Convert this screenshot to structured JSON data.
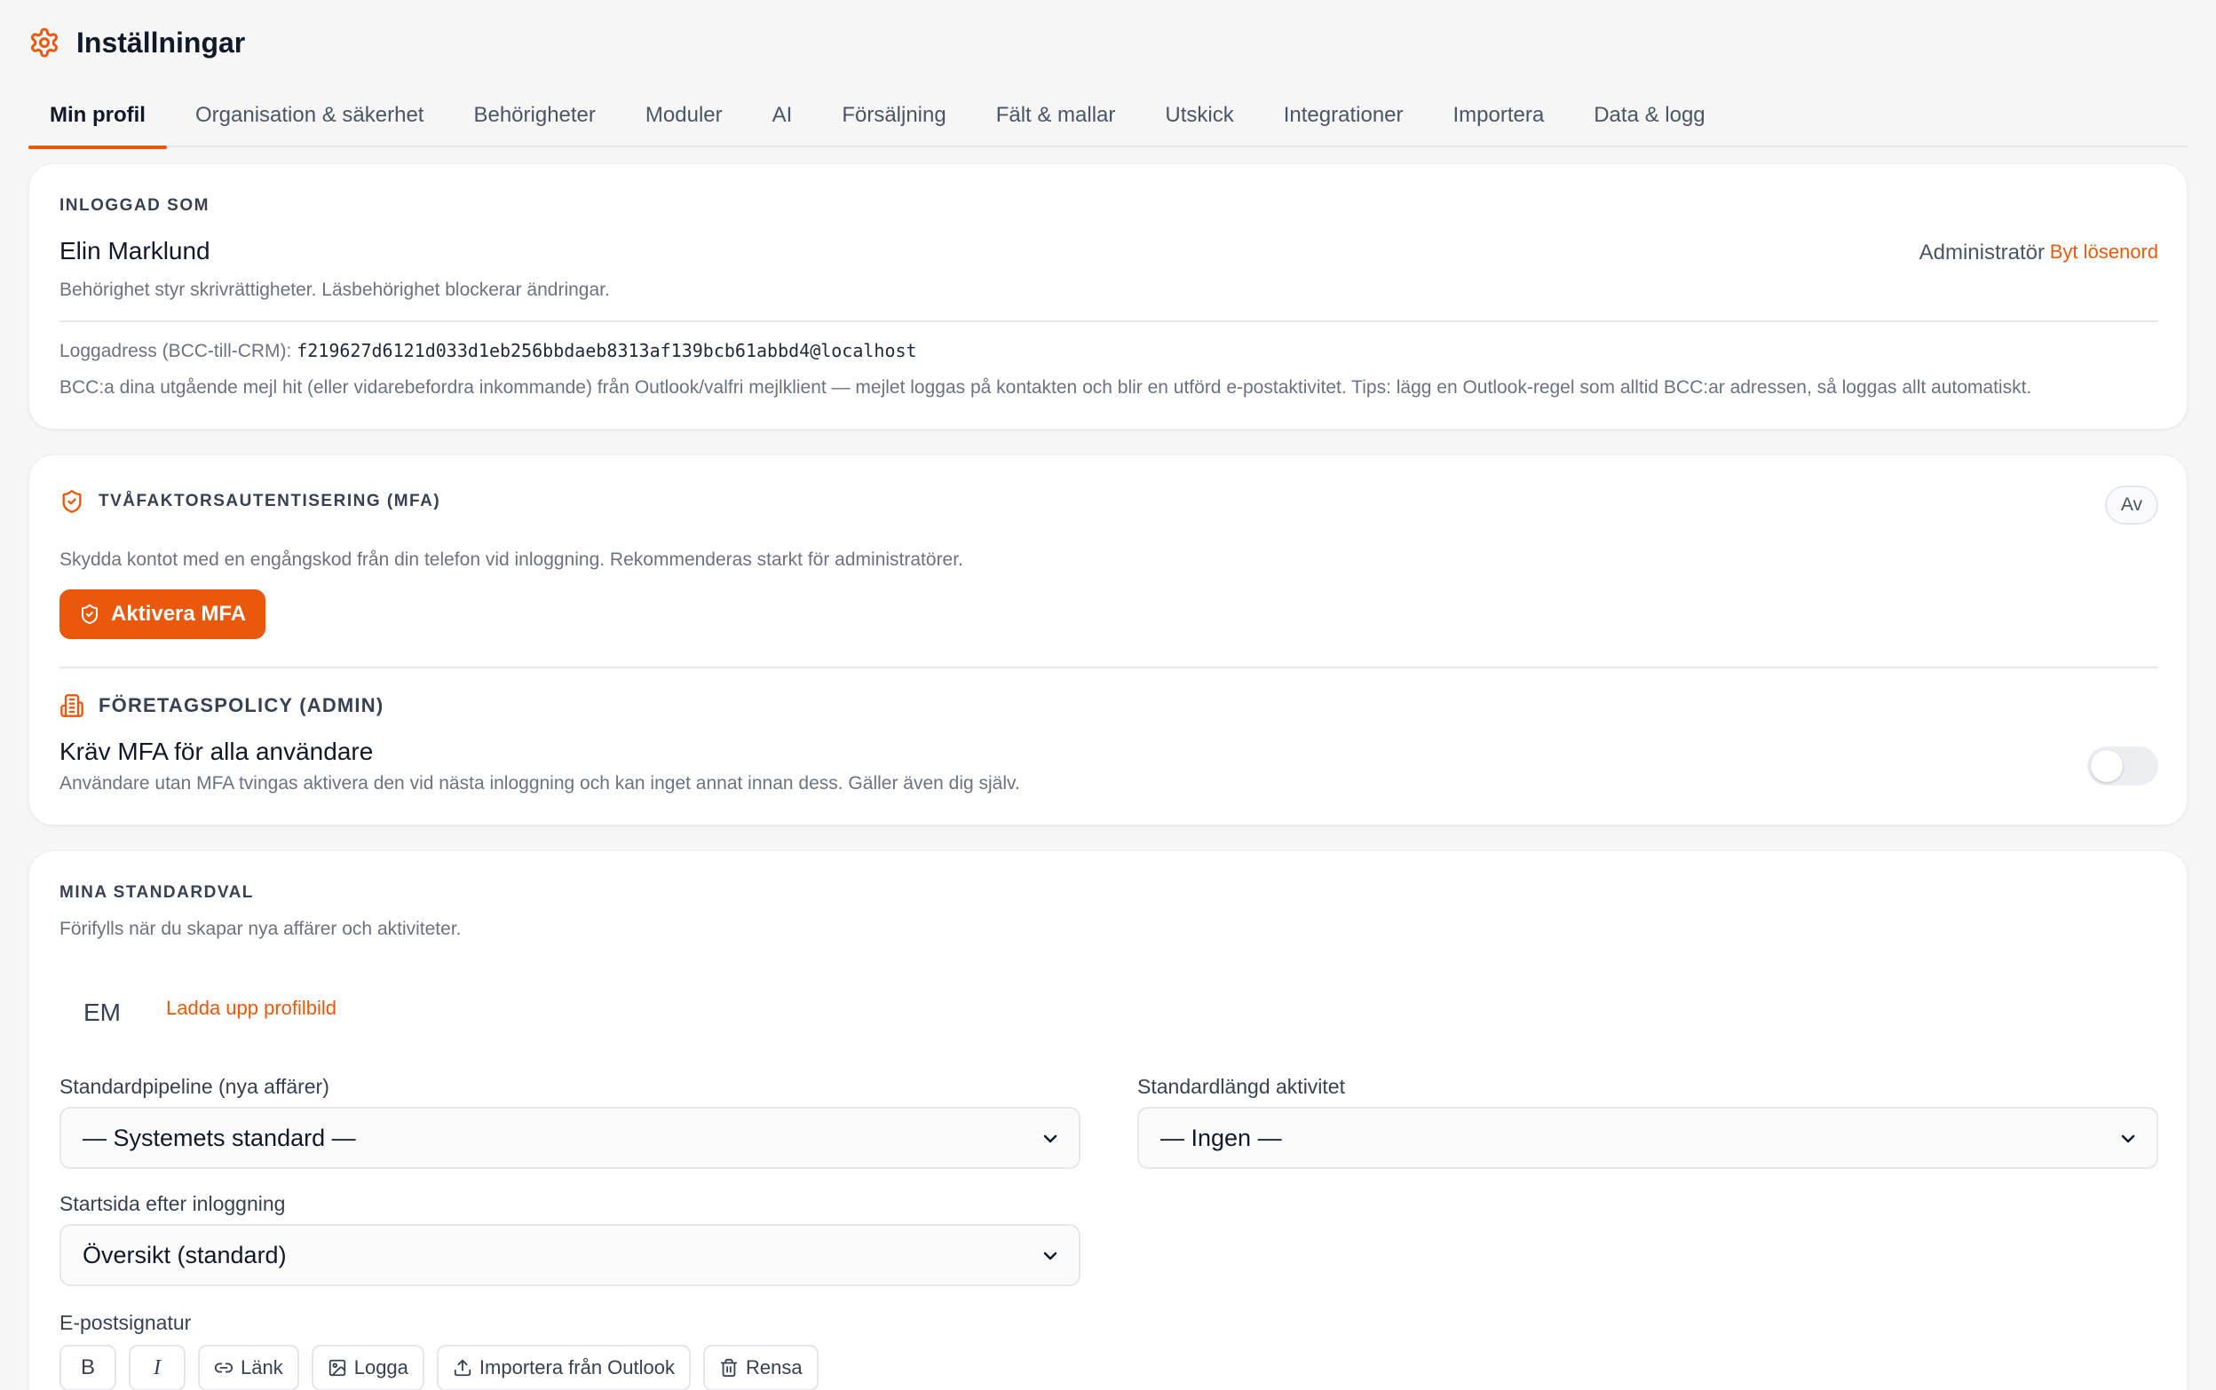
{
  "header": {
    "title": "Inställningar",
    "icon": "gear-icon",
    "accent": "#ea580c"
  },
  "tabs": [
    {
      "label": "Min profil",
      "active": true
    },
    {
      "label": "Organisation & säkerhet"
    },
    {
      "label": "Behörigheter"
    },
    {
      "label": "Moduler"
    },
    {
      "label": "AI"
    },
    {
      "label": "Försäljning"
    },
    {
      "label": "Fält & mallar"
    },
    {
      "label": "Utskick"
    },
    {
      "label": "Integrationer"
    },
    {
      "label": "Importera"
    },
    {
      "label": "Data & logg"
    }
  ],
  "profile": {
    "caption": "INLOGGAD SOM",
    "name": "Elin Marklund",
    "description": "Behörighet styr skrivrättigheter. Läsbehörighet blockerar ändringar.",
    "role": "Administratör",
    "change_password": "Byt lösenord",
    "log_label": "Loggadress (BCC-till-CRM): ",
    "log_address": "f219627d6121d033d1eb256bbdaeb8313af139bcb61abbd4@localhost",
    "bcc_help": "BCC:a dina utgående mejl hit (eller vidarebefordra inkommande) från Outlook/valfri mejlklient — mejlet loggas på kontakten och blir en utförd e-postaktivitet. Tips: lägg en Outlook-regel som alltid BCC:ar adressen, så loggas allt automatiskt."
  },
  "mfa": {
    "caption": "TVÅFAKTORSAUTENTISERING (MFA)",
    "status": "Av",
    "description": "Skydda kontot med en engångskod från din telefon vid inloggning. Rekommenderas starkt för administratörer.",
    "activate_label": "Aktivera MFA",
    "policy_caption": "FÖRETAGSPOLICY (ADMIN)",
    "require_title": "Kräv MFA för alla användare",
    "require_desc": "Användare utan MFA tvingas aktivera den vid nästa inloggning och kan inget annat innan dess. Gäller även dig själv.",
    "require_enabled": false
  },
  "defaults": {
    "caption": "MINA STANDARDVAL",
    "description": "Förifylls när du skapar nya affärer och aktiviteter.",
    "avatar_initials": "EM",
    "upload_label": "Ladda upp profilbild",
    "pipeline_label": "Standardpipeline (nya affärer)",
    "pipeline_value": "— Systemets standard —",
    "duration_label": "Standardlängd aktivitet",
    "duration_value": "— Ingen —",
    "start_label": "Startsida efter inloggning",
    "start_value": "Översikt (standard)",
    "signature_label": "E-postsignatur",
    "toolbar": {
      "bold": "B",
      "italic": "I",
      "link": "Länk",
      "logo": "Logga",
      "import": "Importera från Outlook",
      "clear": "Rensa"
    }
  }
}
